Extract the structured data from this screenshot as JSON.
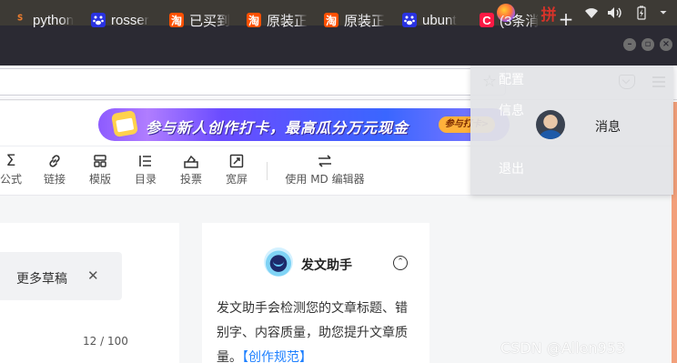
{
  "system_panel": {
    "ime_label": "拼",
    "icons": [
      "firefox-icon",
      "wifi-icon",
      "volume-icon",
      "battery-icon",
      "panel-menu-icon"
    ]
  },
  "browser": {
    "tabs": [
      {
        "label": "python",
        "icon": "python-icon"
      },
      {
        "label": "rosser",
        "icon": "baidu-paw-icon"
      },
      {
        "label": "已买到",
        "icon": "taobao-icon"
      },
      {
        "label": "原装正",
        "icon": "taobao-icon"
      },
      {
        "label": "原装正",
        "icon": "taobao-icon"
      },
      {
        "label": "ubunt",
        "icon": "baidu-paw-icon"
      },
      {
        "label": "(3条消",
        "icon": "csdn-icon"
      }
    ],
    "favicon_glyphs": {
      "taobao": "淘",
      "csdn": "C"
    },
    "new_tab_label": "+",
    "url": ""
  },
  "banner": {
    "text": "参与新人创作打卡，最高瓜分万元现金",
    "cta": "参与打卡>"
  },
  "editor_toolbar": {
    "items": [
      {
        "label": "公式",
        "icon": "formula-icon"
      },
      {
        "label": "链接",
        "icon": "link-icon"
      },
      {
        "label": "模版",
        "icon": "template-icon"
      },
      {
        "label": "目录",
        "icon": "toc-icon"
      },
      {
        "label": "投票",
        "icon": "vote-icon"
      },
      {
        "label": "宽屏",
        "icon": "widescreen-icon"
      },
      {
        "label": "使用 MD 编辑器",
        "icon": "switch-editor-icon"
      }
    ]
  },
  "drafts": {
    "label": "更多草稿",
    "close": "✕",
    "counter": "12 / 100"
  },
  "assistant": {
    "title": "发文助手",
    "description": "发文助手会检测您的文章标题、错别字、内容质量，助您提升文章质量。",
    "link": "【创作规范】"
  },
  "user_menu": {
    "settings": "配置",
    "info": "信息",
    "messages": "消息",
    "logout": "退出"
  },
  "watermark": "CSDN @Allen953",
  "colors": {
    "accent_blue": "#1e80ff",
    "csdn_red": "#fc1944",
    "taobao_orange": "#ff5000",
    "baidu_blue": "#2932e1"
  }
}
